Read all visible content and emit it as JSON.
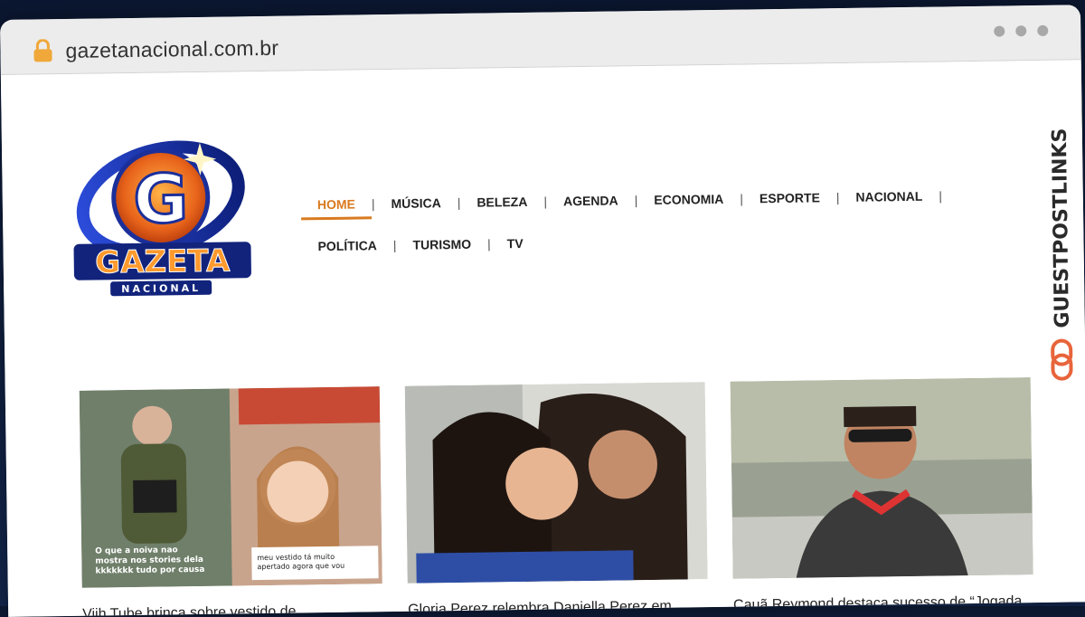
{
  "browser": {
    "url": "gazetanacional.com.br"
  },
  "logo": {
    "letter": "G",
    "name": "GAZETA",
    "sub": "NACIONAL"
  },
  "nav": {
    "row1": [
      "HOME",
      "MÚSICA",
      "BELEZA",
      "AGENDA",
      "ECONOMIA",
      "ESPORTE",
      "NACIONAL"
    ],
    "row2": [
      "POLÍTICA",
      "TURISMO",
      "TV"
    ],
    "active": "HOME",
    "accent": "#d97a1f"
  },
  "cards": [
    {
      "title": "Viih Tube brinca sobre vestido de",
      "overlay_left": "O que a noiva nao mostra nos stories dela kkkkkkk tudo por causa de um vestido kkk",
      "overlay_right": "meu vestido tá muito apertado agora que vou menstruar e agora"
    },
    {
      "title": "Gloria Perez relembra Daniella Perez em"
    },
    {
      "title": "Cauã Reymond destaca sucesso de “Jogada de Pirar” e fala sobre nova fase como"
    }
  ],
  "side_brand": "GUESTPOSTLINKS"
}
